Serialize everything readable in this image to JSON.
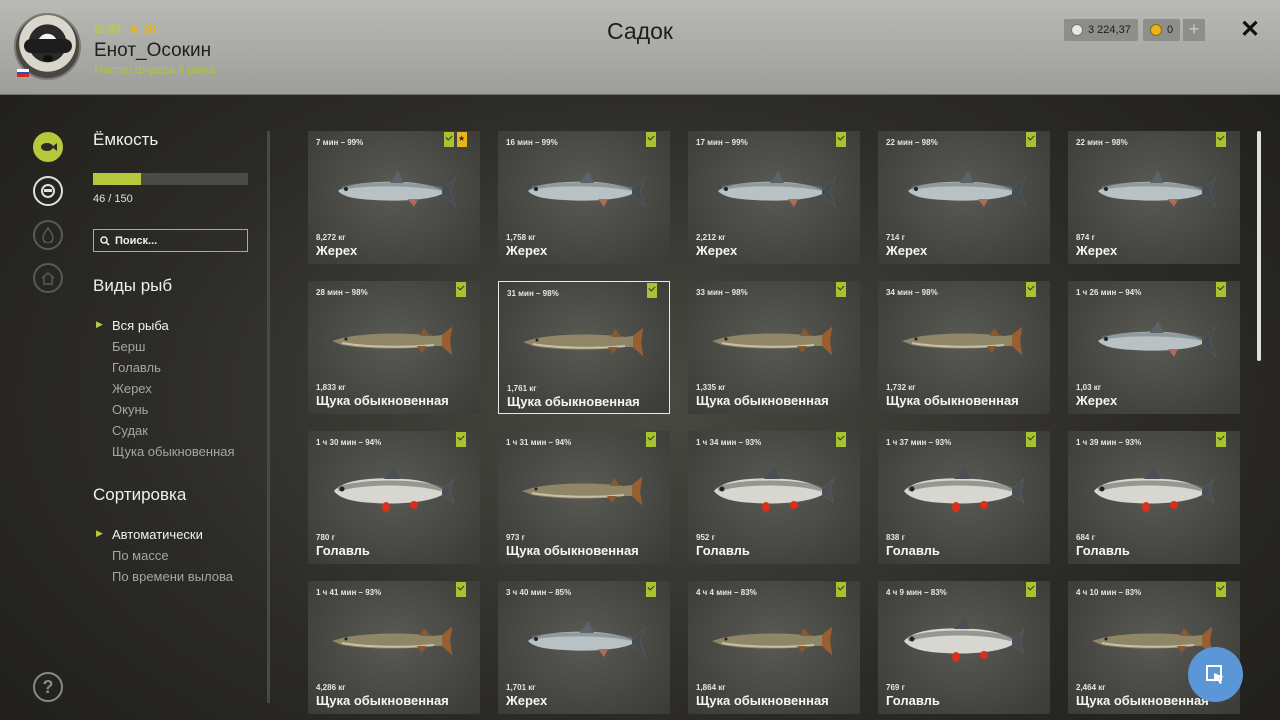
{
  "header": {
    "level": "39",
    "stars": "30",
    "username": "Енот_Осокин",
    "rank": "Мастер фидера 5 ранга",
    "title": "Садок",
    "silver": "3 224,37",
    "gold": "0",
    "plus": "+",
    "close": "✕"
  },
  "sidebar": {
    "capacity_title": "Ёмкость",
    "capacity_text": "46 / 150",
    "capacity_fraction": 0.307,
    "search_placeholder": "Поиск...",
    "species_title": "Виды рыб",
    "species": [
      "Вся рыба",
      "Берш",
      "Голавль",
      "Жерех",
      "Окунь",
      "Судак",
      "Щука обыкновенная"
    ],
    "sort_title": "Сортировка",
    "sort": [
      "Автоматически",
      "По массе",
      "По времени вылова"
    ],
    "help": "?"
  },
  "fish": [
    {
      "time": "7 мин – 99%",
      "weight": "8,272 кг",
      "name": "Жерех",
      "kind": "asp",
      "star": true
    },
    {
      "time": "16 мин – 99%",
      "weight": "1,758 кг",
      "name": "Жерех",
      "kind": "asp"
    },
    {
      "time": "17 мин – 99%",
      "weight": "2,212 кг",
      "name": "Жерех",
      "kind": "asp"
    },
    {
      "time": "22 мин – 98%",
      "weight": "714 г",
      "name": "Жерех",
      "kind": "asp"
    },
    {
      "time": "22 мин – 98%",
      "weight": "874 г",
      "name": "Жерех",
      "kind": "asp"
    },
    {
      "time": "28 мин – 98%",
      "weight": "1,833 кг",
      "name": "Щука обыкновенная",
      "kind": "pike"
    },
    {
      "time": "31 мин – 98%",
      "weight": "1,761 кг",
      "name": "Щука обыкновенная",
      "kind": "pike",
      "selected": true
    },
    {
      "time": "33 мин – 98%",
      "weight": "1,335 кг",
      "name": "Щука обыкновенная",
      "kind": "pike"
    },
    {
      "time": "34 мин – 98%",
      "weight": "1,732 кг",
      "name": "Щука обыкновенная",
      "kind": "pike"
    },
    {
      "time": "1 ч 26 мин – 94%",
      "weight": "1,03 кг",
      "name": "Жерех",
      "kind": "asp"
    },
    {
      "time": "1 ч 30 мин – 94%",
      "weight": "780 г",
      "name": "Голавль",
      "kind": "chub"
    },
    {
      "time": "1 ч 31 мин – 94%",
      "weight": "973 г",
      "name": "Щука обыкновенная",
      "kind": "pike"
    },
    {
      "time": "1 ч 34 мин – 93%",
      "weight": "952 г",
      "name": "Голавль",
      "kind": "chub"
    },
    {
      "time": "1 ч 37 мин – 93%",
      "weight": "838 г",
      "name": "Голавль",
      "kind": "chub"
    },
    {
      "time": "1 ч 39 мин – 93%",
      "weight": "684 г",
      "name": "Голавль",
      "kind": "chub"
    },
    {
      "time": "1 ч 41 мин – 93%",
      "weight": "4,286 кг",
      "name": "Щука обыкновенная",
      "kind": "pike"
    },
    {
      "time": "3 ч 40 мин – 85%",
      "weight": "1,701 кг",
      "name": "Жерех",
      "kind": "asp"
    },
    {
      "time": "4 ч 4 мин – 83%",
      "weight": "1,864 кг",
      "name": "Щука обыкновенная",
      "kind": "pike"
    },
    {
      "time": "4 ч 9 мин – 83%",
      "weight": "769 г",
      "name": "Голавль",
      "kind": "chub"
    },
    {
      "time": "4 ч 10 мин – 83%",
      "weight": "2,464 кг",
      "name": "Щука обыкновенная",
      "kind": "pike"
    }
  ],
  "colors": {
    "accent": "#b6c93d",
    "gold": "#e8b51e",
    "fab": "#5b96d6"
  }
}
